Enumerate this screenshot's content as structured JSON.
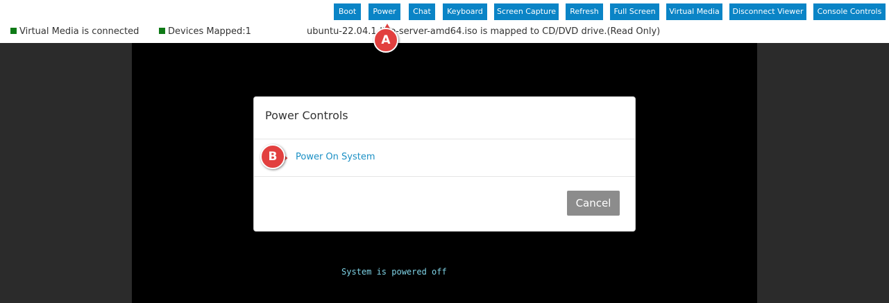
{
  "toolbar": {
    "buttons": [
      {
        "label": "Boot"
      },
      {
        "label": "Power"
      },
      {
        "label": "Chat"
      },
      {
        "label": "Keyboard"
      },
      {
        "label": "Screen Capture"
      },
      {
        "label": "Refresh"
      },
      {
        "label": "Full Screen"
      },
      {
        "label": "Virtual Media"
      },
      {
        "label": "Disconnect Viewer"
      },
      {
        "label": "Console Controls"
      }
    ],
    "button_color": "#0a84c6"
  },
  "status": {
    "virtual_media": "Virtual Media is connected",
    "devices_mapped": "Devices Mapped:1",
    "mapped_message": "ubuntu-22.04.1-live-server-amd64.iso is mapped to CD/DVD drive.(Read Only)",
    "indicator_color": "#0e7a16"
  },
  "console": {
    "message": "System is powered off"
  },
  "modal": {
    "title": "Power Controls",
    "option": "Power On System",
    "cancel_label": "Cancel"
  },
  "callouts": {
    "a": "A",
    "b": "B",
    "color": "#e2403f"
  }
}
